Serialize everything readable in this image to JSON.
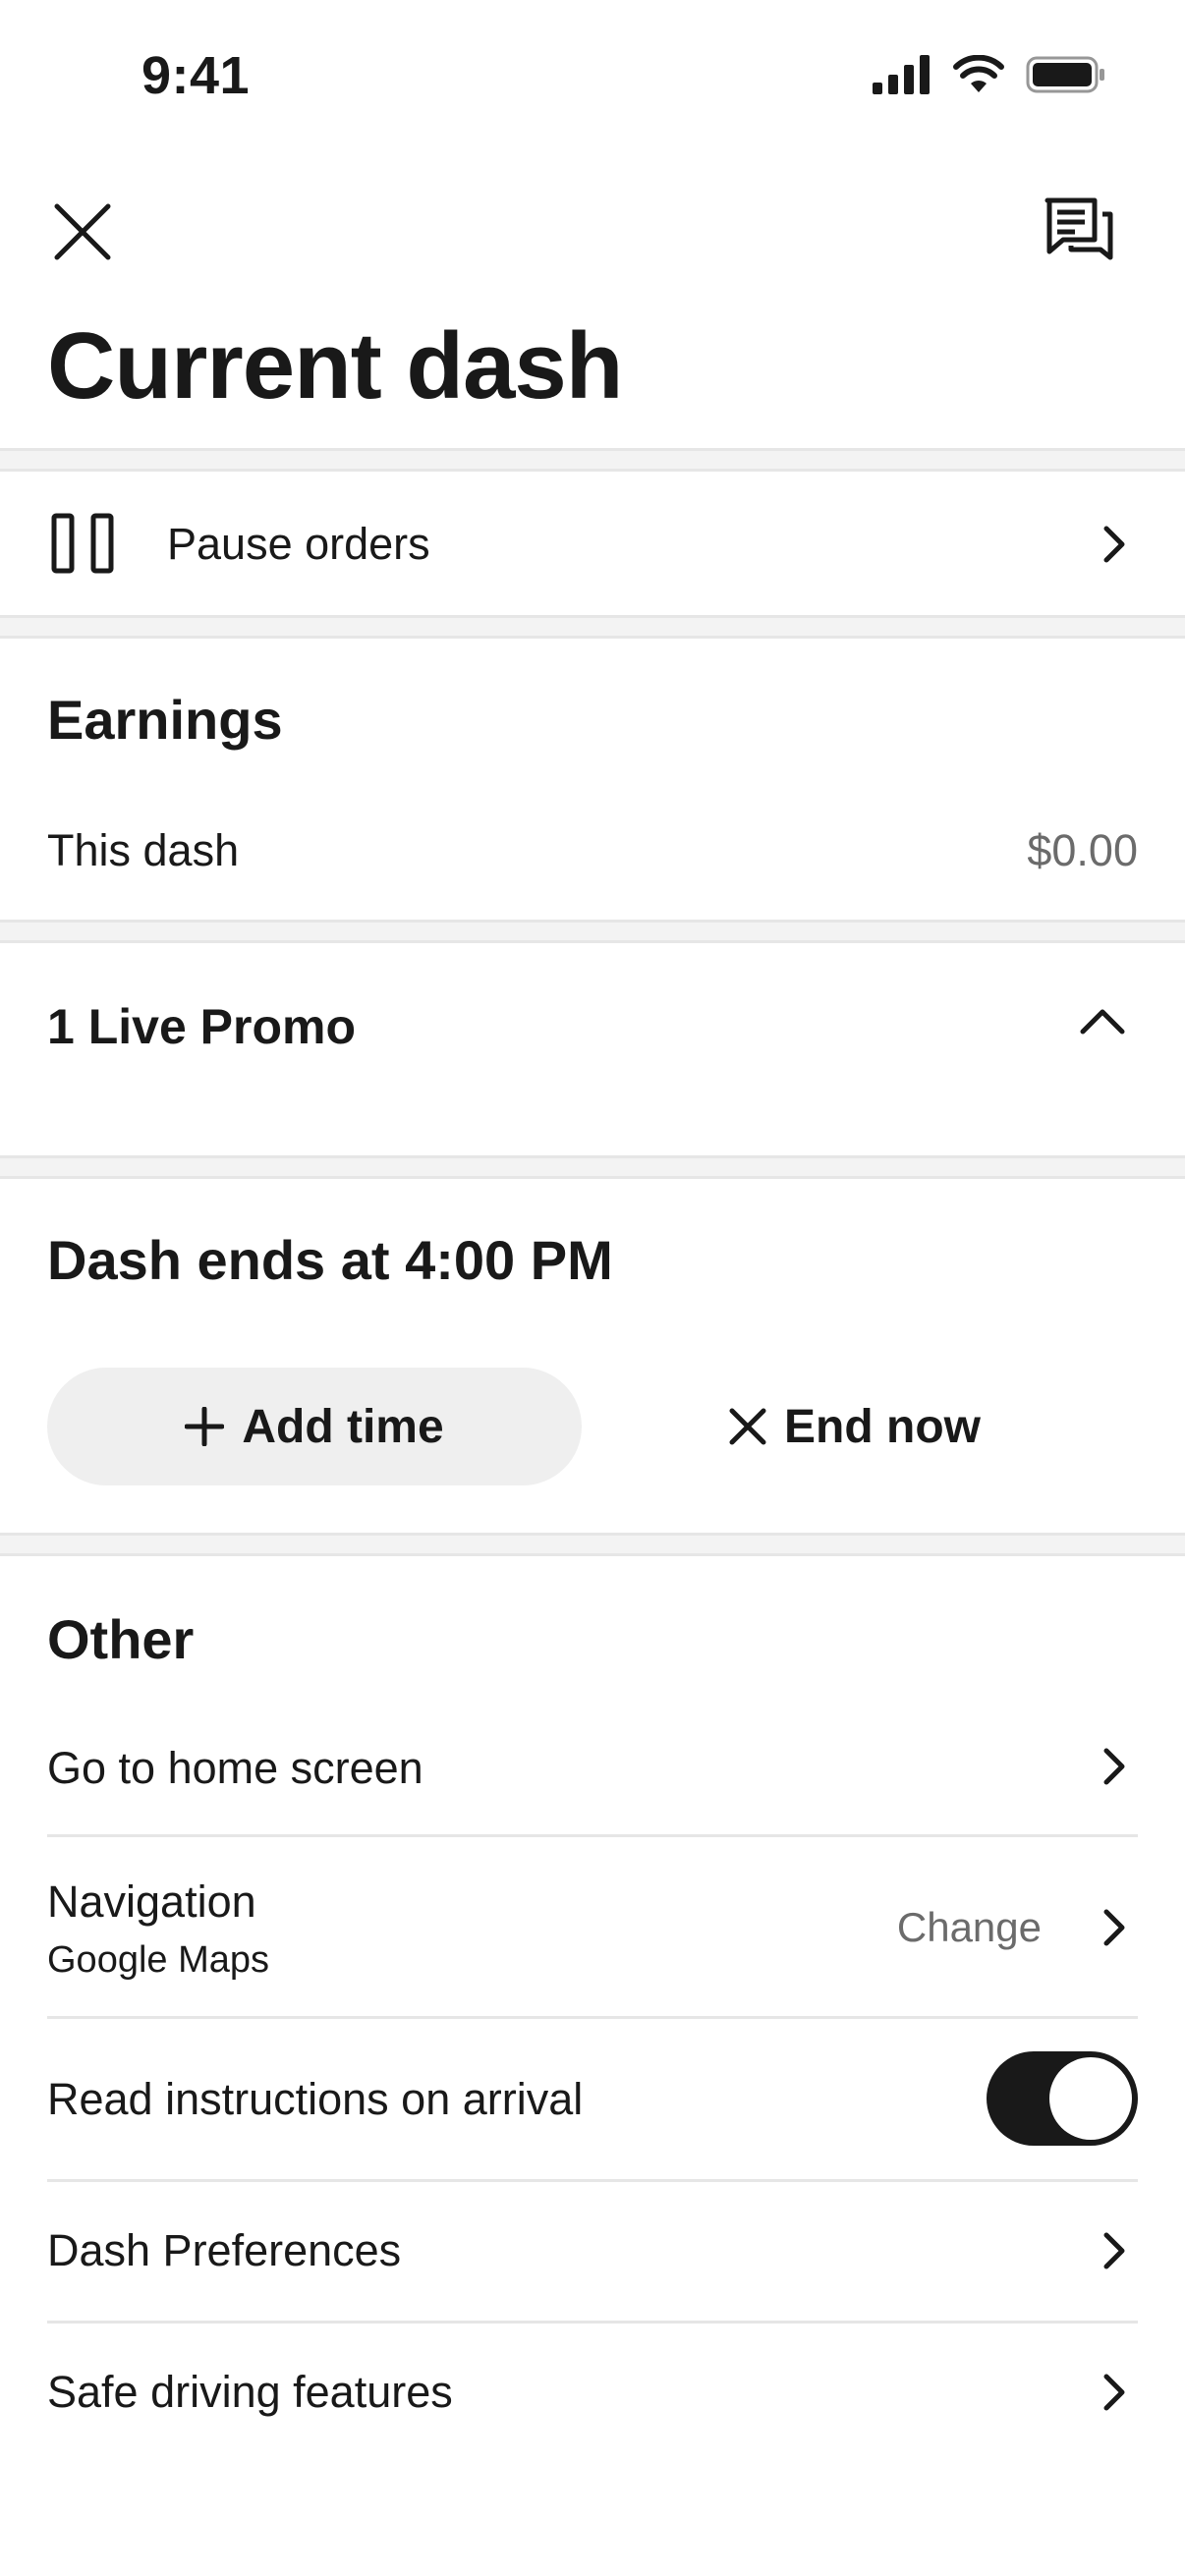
{
  "status_bar": {
    "time": "9:41"
  },
  "header": {
    "close_icon": "close-icon",
    "chat_icon": "chat-icon",
    "title": "Current dash"
  },
  "pause": {
    "label": "Pause orders",
    "icon": "pause-icon"
  },
  "earnings": {
    "title": "Earnings",
    "this_dash_label": "This dash",
    "this_dash_value": "$0.00"
  },
  "promo": {
    "title": "1 Live Promo",
    "expanded": true
  },
  "dash_end": {
    "title": "Dash ends at 4:00 PM",
    "add_time_label": "Add time",
    "end_now_label": "End now"
  },
  "other": {
    "title": "Other",
    "go_home_label": "Go to home screen",
    "navigation_label": "Navigation",
    "navigation_value": "Google Maps",
    "navigation_action": "Change",
    "read_instructions_label": "Read instructions on arrival",
    "read_instructions_on": true,
    "dash_preferences_label": "Dash Preferences",
    "safe_driving_label": "Safe driving features"
  },
  "colors": {
    "text": "#191919",
    "secondary": "#6b6b6b",
    "band": "#f3f3f3",
    "toggle_on": "#191919"
  }
}
